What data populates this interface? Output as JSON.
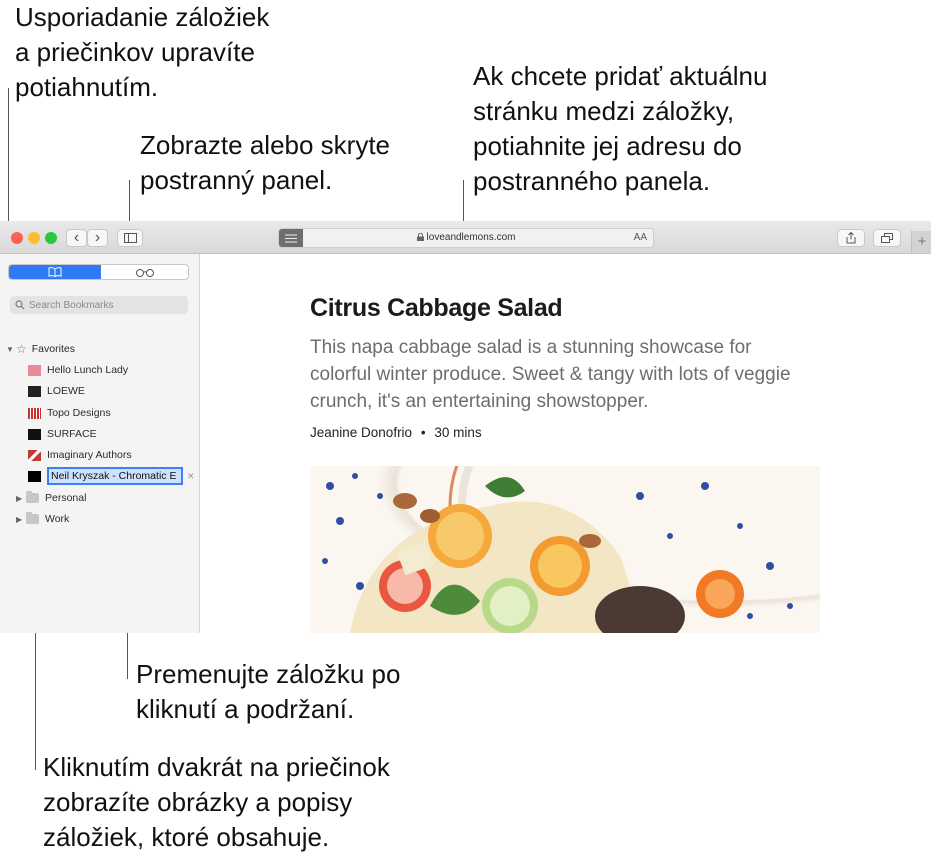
{
  "callouts": {
    "reorder": "Usporiadanie záložiek\na priečinkov upravíte\npotiahnutím.",
    "sidebar": "Zobrazte alebo skryte\npostranný panel.",
    "add": "Ak chcete pridať aktuálnu\nstránku medzi záložky,\npotiahnite jej adresu do\npostranného panela.",
    "rename": "Premenujte záložku po\nkliknutí a podržaní.",
    "folder": "Kliknutím dvakrát na priečinok\nzobrazíte obrázky a popisy\nzáložiek, ktoré obsahuje."
  },
  "browser": {
    "url": "loveandlemons.com",
    "text_size": "AA",
    "nav_back": "‹",
    "nav_forward": "›",
    "new_tab": "+"
  },
  "sidebar": {
    "search_placeholder": "Search Bookmarks",
    "favorites_label": "Favorites",
    "bookmarks": [
      {
        "label": "Hello Lunch Lady",
        "color": "#e88a98"
      },
      {
        "label": "LOEWE",
        "color": "#222222"
      },
      {
        "label": "Topo Designs",
        "color": "#c8312f"
      },
      {
        "label": "SURFACE",
        "color": "#111111"
      },
      {
        "label": "Imaginary Authors",
        "color": "#c23b3b"
      }
    ],
    "editing_bookmark": "Neil Kryszak - Chromatic E",
    "folders": [
      "Personal",
      "Work"
    ]
  },
  "article": {
    "title": "Citrus Cabbage Salad",
    "description": "This napa cabbage salad is a stunning showcase for colorful winter produce. Sweet & tangy with lots of veggie crunch, it's an entertaining showstopper.",
    "author": "Jeanine Donofrio",
    "separator": "•",
    "duration": "30 mins"
  }
}
